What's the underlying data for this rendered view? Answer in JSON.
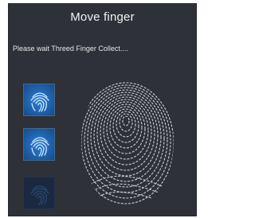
{
  "dialog": {
    "title": "Move finger",
    "status_text": "Please wait Threed Finger Collect...."
  },
  "thumbnails": [
    {
      "state": "captured",
      "icon": "fingerprint-icon"
    },
    {
      "state": "captured",
      "icon": "fingerprint-icon"
    },
    {
      "state": "pending",
      "icon": "fingerprint-icon"
    }
  ],
  "colors": {
    "panel_bg": "#2e3138",
    "thumb_active": "#2c7ed4",
    "thumb_pending": "#1b2940",
    "ridge_color": "#d9dde2"
  }
}
